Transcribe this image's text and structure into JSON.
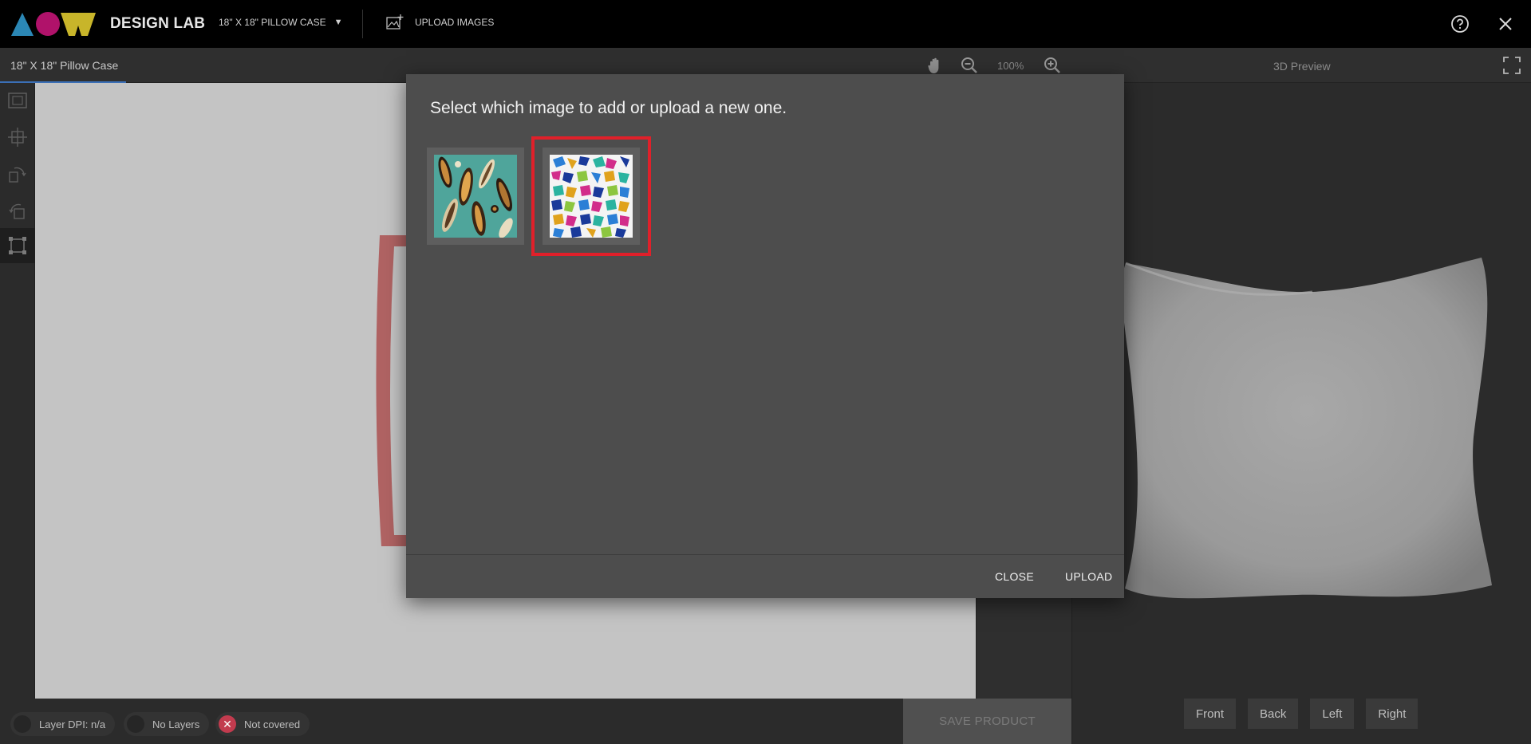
{
  "header": {
    "app_title": "DESIGN LAB",
    "product_select": "18\" X 18\" PILLOW CASE",
    "upload_images": "UPLOAD IMAGES",
    "logo_colors": [
      "#2b87b5",
      "#b0126a",
      "#c8b52a"
    ]
  },
  "subbar": {
    "doc_tab": "18\" X 18\" Pillow Case",
    "zoom_level": "100%",
    "preview_title": "3D Preview"
  },
  "modal": {
    "title": "Select which image to add or upload a new one.",
    "images": [
      {
        "name": "feathers-pattern",
        "selected": false
      },
      {
        "name": "gems-pattern",
        "selected": true
      }
    ],
    "close_label": "CLOSE",
    "upload_label": "UPLOAD",
    "selection_color": "#e0202a"
  },
  "status": {
    "layer_dpi": "Layer DPI: n/a",
    "layers": "No Layers",
    "coverage": "Not covered"
  },
  "actions": {
    "save_product": "SAVE PRODUCT"
  },
  "preview": {
    "views": [
      "Front",
      "Back",
      "Left",
      "Right"
    ]
  }
}
